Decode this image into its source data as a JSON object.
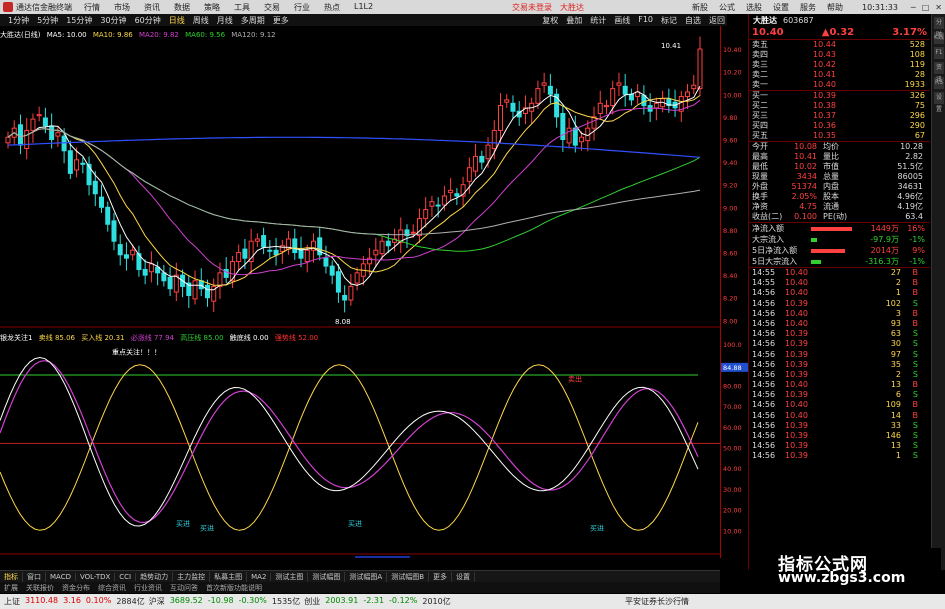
{
  "titlebar": {
    "app_name": "通达信金融终端",
    "menu": [
      "行情",
      "市场",
      "资讯",
      "数据",
      "策略",
      "工具",
      "交易",
      "行业",
      "热点"
    ],
    "version": "L1L2",
    "promo": [
      "交易未登录",
      "大胜达"
    ],
    "right_menu": [
      "新股",
      "公式",
      "选股",
      "设置",
      "服务",
      "帮助"
    ],
    "clock": "10:31:33"
  },
  "toolbar": {
    "periods": [
      "1分钟",
      "5分钟",
      "15分钟",
      "30分钟",
      "60分钟",
      "日线",
      "周线",
      "月线",
      "多周期",
      "更多"
    ],
    "active_period": "日线",
    "right_items": [
      "复权",
      "叠加",
      "统计",
      "画线",
      "F10",
      "标记",
      "自选",
      "返回"
    ]
  },
  "main_info": {
    "stock_period": "大胜达(日线)",
    "ma5": "MA5: 10.00",
    "ma10": "MA10: 9.86",
    "ma20": "MA20: 9.82",
    "ma60": "MA60: 9.56",
    "ma120": "MA120: 9.12",
    "colors": {
      "ma5": "#ffffff",
      "ma10": "#ffd84a",
      "ma20": "#d040d0",
      "ma60": "#30d030",
      "ma120": "#b0b0b0",
      "ma250": "#3050ff"
    }
  },
  "price_annotations": {
    "high_label": "10.41",
    "low_label": "8.08"
  },
  "price_axis": [
    "10.40",
    "10.20",
    "10.00",
    "9.80",
    "9.60",
    "9.40",
    "9.20",
    "9.00",
    "8.80",
    "8.60",
    "8.40",
    "8.20",
    "8.00"
  ],
  "indicator_info": {
    "name": "银龙关注1",
    "items": [
      {
        "label": "卖线",
        "value": "85.06",
        "color": "#ffd84a"
      },
      {
        "label": "买入线",
        "value": "20.31",
        "color": "#ffd84a"
      },
      {
        "label": "必涨线",
        "value": "77.94",
        "color": "#d040d0"
      },
      {
        "label": "高压线",
        "value": "85.00",
        "color": "#30d030"
      },
      {
        "label": "触底线",
        "value": "0.00",
        "color": "#ffffff"
      },
      {
        "label": "强势线",
        "value": "52.00",
        "color": "#ff3030"
      }
    ]
  },
  "indicator_axis": [
    "100.0",
    "90.00",
    "80.00",
    "70.00",
    "60.00",
    "50.00",
    "40.00",
    "30.00",
    "20.00",
    "10.00"
  ],
  "indicator_value_tag": "84.88",
  "indicator_annotations": {
    "focus": "重点关注！！！",
    "buy": "买进",
    "sell": "卖出"
  },
  "date_axis": {
    "start": "2023年",
    "selected": "2023/06/30/五"
  },
  "quote": {
    "name": "大胜达",
    "code": "603687",
    "price": "10.40",
    "change": "▲0.32",
    "pct": "3.17%",
    "asks": [
      {
        "label": "卖五",
        "price": "10.44",
        "vol": "528"
      },
      {
        "label": "卖四",
        "price": "10.43",
        "vol": "108"
      },
      {
        "label": "卖三",
        "price": "10.42",
        "vol": "119"
      },
      {
        "label": "卖二",
        "price": "10.41",
        "vol": "28"
      },
      {
        "label": "卖一",
        "price": "10.40",
        "vol": "1933"
      }
    ],
    "bids": [
      {
        "label": "买一",
        "price": "10.39",
        "vol": "326"
      },
      {
        "label": "买二",
        "price": "10.38",
        "vol": "75"
      },
      {
        "label": "买三",
        "price": "10.37",
        "vol": "296"
      },
      {
        "label": "买四",
        "price": "10.36",
        "vol": "290"
      },
      {
        "label": "买五",
        "price": "10.35",
        "vol": "67"
      }
    ],
    "stats": [
      {
        "l1": "今开",
        "v1": "10.08",
        "l2": "均价",
        "v2": "10.28"
      },
      {
        "l1": "最高",
        "v1": "10.41",
        "l2": "量比",
        "v2": "2.82"
      },
      {
        "l1": "最低",
        "v1": "10.02",
        "l2": "市值",
        "v2": "51.5亿"
      },
      {
        "l1": "现量",
        "v1": "3434",
        "l2": "总量",
        "v2": "86005"
      },
      {
        "l1": "外盘",
        "v1": "51374",
        "l2": "内盘",
        "v2": "34631"
      },
      {
        "l1": "换手",
        "v1": "2.05%",
        "l2": "股本",
        "v2": "4.96亿"
      },
      {
        "l1": "净资",
        "v1": "4.75",
        "l2": "流通",
        "v2": "4.19亿"
      },
      {
        "l1": "收益(二)",
        "v1": "0.100",
        "l2": "PE(动)",
        "v2": "63.4"
      }
    ],
    "flows": [
      {
        "label": "净流入额",
        "bar": 0.85,
        "value": "1449万",
        "pct": "16%",
        "color": "#ff4040"
      },
      {
        "label": "大宗流入",
        "bar": 0.12,
        "value": "-97.9万",
        "pct": "-1%",
        "color": "#30d030"
      },
      {
        "label": "5日净流入额",
        "bar": 0.7,
        "value": "2014万",
        "pct": "9%",
        "color": "#ff4040"
      },
      {
        "label": "5日大宗流入",
        "bar": 0.2,
        "value": "-316.3万",
        "pct": "-1%",
        "color": "#30d030"
      }
    ],
    "ticks": [
      {
        "t": "14:55",
        "p": "10.40",
        "v": "27",
        "d": "B"
      },
      {
        "t": "14:55",
        "p": "10.40",
        "v": "2",
        "d": "B"
      },
      {
        "t": "14:56",
        "p": "10.40",
        "v": "1",
        "d": "B"
      },
      {
        "t": "14:56",
        "p": "10.39",
        "v": "102",
        "d": "S"
      },
      {
        "t": "14:56",
        "p": "10.40",
        "v": "3",
        "d": "B"
      },
      {
        "t": "14:56",
        "p": "10.40",
        "v": "93",
        "d": "B"
      },
      {
        "t": "14:56",
        "p": "10.39",
        "v": "63",
        "d": "S"
      },
      {
        "t": "14:56",
        "p": "10.39",
        "v": "30",
        "d": "S"
      },
      {
        "t": "14:56",
        "p": "10.39",
        "v": "97",
        "d": "S"
      },
      {
        "t": "14:56",
        "p": "10.39",
        "v": "35",
        "d": "S"
      },
      {
        "t": "14:56",
        "p": "10.39",
        "v": "2",
        "d": "S"
      },
      {
        "t": "14:56",
        "p": "10.40",
        "v": "13",
        "d": "B"
      },
      {
        "t": "14:56",
        "p": "10.39",
        "v": "6",
        "d": "S"
      },
      {
        "t": "14:56",
        "p": "10.40",
        "v": "109",
        "d": "B"
      },
      {
        "t": "14:56",
        "p": "10.40",
        "v": "14",
        "d": "B"
      },
      {
        "t": "14:56",
        "p": "10.39",
        "v": "33",
        "d": "S"
      },
      {
        "t": "14:56",
        "p": "10.39",
        "v": "146",
        "d": "S"
      },
      {
        "t": "14:56",
        "p": "10.39",
        "v": "13",
        "d": "S"
      },
      {
        "t": "14:56",
        "p": "10.39",
        "v": "1",
        "d": "S"
      }
    ]
  },
  "tabs": [
    "指标",
    "窗口",
    "MACD",
    "VOL-TDX",
    "CCI",
    "趋势动力",
    "主力监控",
    "私募主图",
    "MA2",
    "测试主图",
    "测试幅图",
    "测试幅图A",
    "测试幅图B",
    "更多",
    "设置"
  ],
  "tabs2": [
    "扩展",
    "关联报价",
    "资金分布",
    "综合资讯",
    "行业资讯",
    "互动问答",
    "首次新版功能说明"
  ],
  "status": {
    "sh_label": "上证",
    "sh_val": "3110.48",
    "sh_chg": "3.16",
    "sh_pct": "0.10%",
    "sh_amt": "2884亿",
    "sz_label": "沪深",
    "sz_val": "3689.52",
    "sz_chg": "-10.98",
    "sz_pct": "-0.30%",
    "sz_amt": "1535亿",
    "cy_label": "创业",
    "cy_val": "2003.91",
    "cy_chg": "-2.31",
    "cy_pct": "-0.12%",
    "cy_amt": "2010亿",
    "broker": "平安证券长沙行情"
  },
  "watermark": {
    "line1": "指标公式网",
    "line2": "www.zbgs3.com"
  },
  "side_labels": [
    "分时",
    "K线",
    "F10",
    "资讯",
    "RSI",
    "设置"
  ]
}
